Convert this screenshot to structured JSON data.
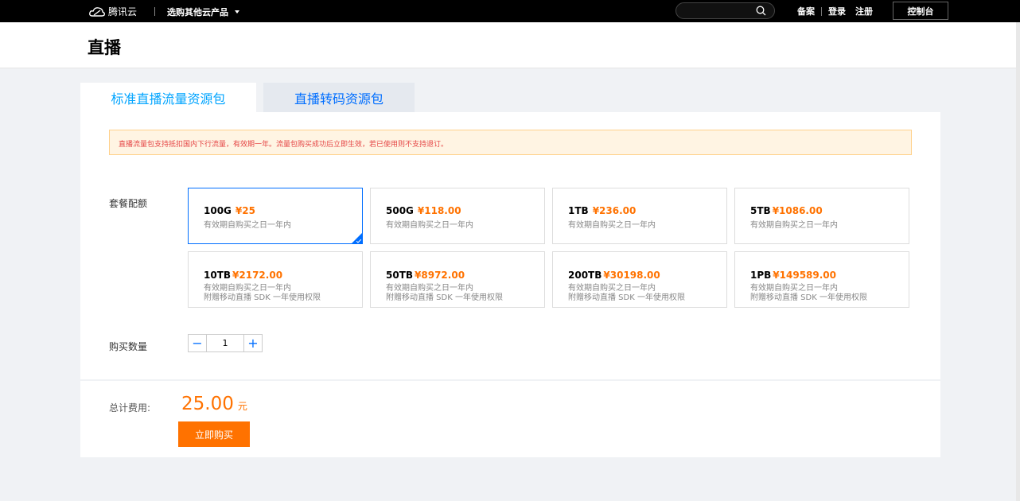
{
  "topbar": {
    "brand": "腾讯云",
    "products_menu": "选购其他云产品",
    "search": {
      "value": "",
      "placeholder": ""
    },
    "links": [
      "备案",
      "登录",
      "注册"
    ],
    "console": "控制台"
  },
  "page": {
    "title": "直播"
  },
  "tabs": [
    {
      "label": "标准直播流量资源包",
      "active": true
    },
    {
      "label": "直播转码资源包",
      "active": false
    }
  ],
  "notice": "直播流量包支持抵扣国内下行流量，有效期一年。流量包购买成功后立即生效，若已使用则不支持退订。",
  "packages": {
    "label": "套餐配额",
    "items": [
      {
        "name": "100G",
        "price": "¥25",
        "validity": "有效期自购买之日一年内",
        "gift": "",
        "selected": true
      },
      {
        "name": "500G",
        "price": "¥118.00",
        "validity": "有效期自购买之日一年内",
        "gift": "",
        "selected": false
      },
      {
        "name": "1TB",
        "price": "¥236.00",
        "validity": "有效期自购买之日一年内",
        "gift": "",
        "selected": false
      },
      {
        "name": "5TB",
        "price": "¥1086.00",
        "validity": "有效期自购买之日一年内",
        "gift": "",
        "selected": false
      },
      {
        "name": "10TB",
        "price": "¥2172.00",
        "validity": "有效期自购买之日一年内",
        "gift": "附赠移动直播 SDK 一年使用权限",
        "selected": false
      },
      {
        "name": "50TB",
        "price": "¥8972.00",
        "validity": "有效期自购买之日一年内",
        "gift": "附赠移动直播 SDK 一年使用权限",
        "selected": false
      },
      {
        "name": "200TB",
        "price": "¥30198.00",
        "validity": "有效期自购买之日一年内",
        "gift": "附赠移动直播 SDK 一年使用权限",
        "selected": false
      },
      {
        "name": "1PB",
        "price": "¥149589.00",
        "validity": "有效期自购买之日一年内",
        "gift": "附赠移动直播 SDK 一年使用权限",
        "selected": false
      }
    ]
  },
  "quantity": {
    "label": "购买数量",
    "value": "1",
    "minus": "−",
    "plus": "+"
  },
  "total": {
    "label": "总计费用:",
    "value": "25.00",
    "unit": "元"
  },
  "buy_button": "立即购买",
  "colors": {
    "accent": "#006eff",
    "price": "#ff7200",
    "notice_bg": "#fff4e3"
  }
}
